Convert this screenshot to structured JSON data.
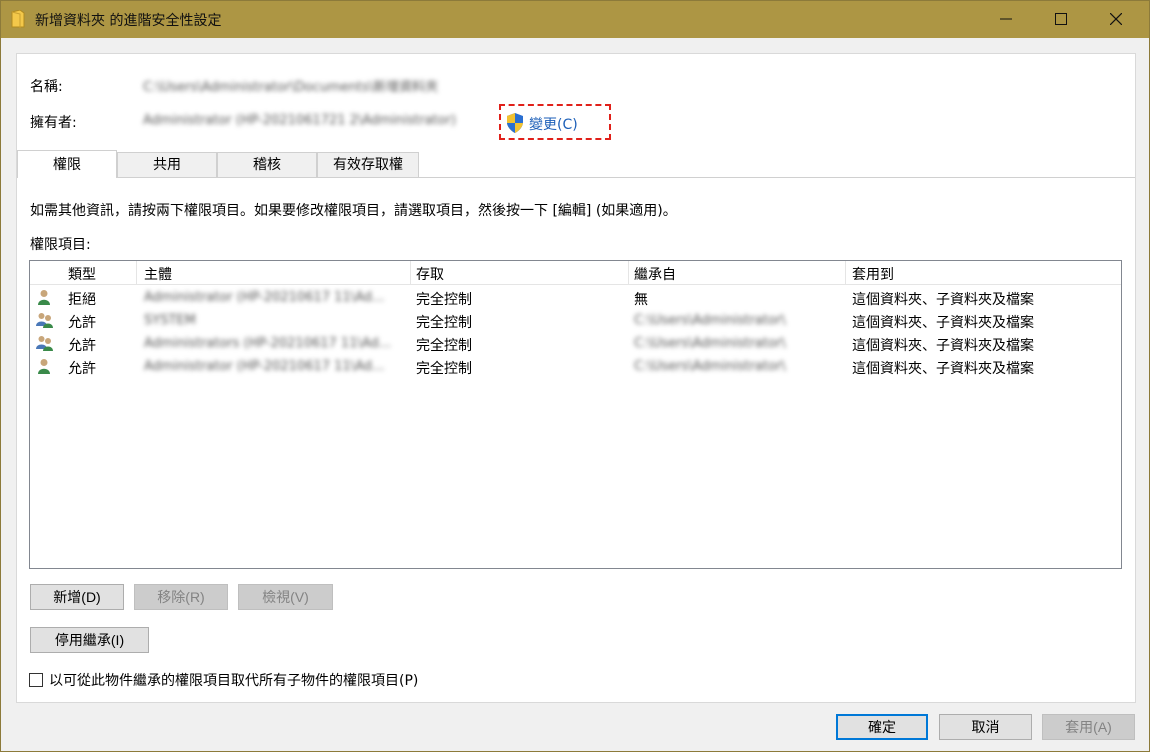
{
  "window": {
    "title": "新增資料夾 的進階安全性設定"
  },
  "header": {
    "name_label": "名稱:",
    "name_value": "C:\\Users\\Administrator\\Documents\\新增資料夾",
    "owner_label": "擁有者:",
    "owner_value": "Administrator (HP-2021061721 2\\Administrator)",
    "change_link": "變更(C)"
  },
  "tabs": [
    "權限",
    "共用",
    "稽核",
    "有效存取權"
  ],
  "active_tab": "權限",
  "description": "如需其他資訊，請按兩下權限項目。如果要修改權限項目，請選取項目，然後按一下 [編輯] (如果適用)。",
  "list_label": "權限項目:",
  "columns": [
    "類型",
    "主體",
    "存取",
    "繼承自",
    "套用到"
  ],
  "rows": [
    {
      "icon": "user-icon",
      "type": "拒絕",
      "principal": "Administrator (HP-20210617 11\\Ad...",
      "access": "完全控制",
      "inherited": "無",
      "applies": "這個資料夾、子資料夾及檔案"
    },
    {
      "icon": "users-icon",
      "type": "允許",
      "principal": "SYSTEM",
      "access": "完全控制",
      "inherited": "C:\\Users\\Administrator\\",
      "applies": "這個資料夾、子資料夾及檔案"
    },
    {
      "icon": "users-icon",
      "type": "允許",
      "principal": "Administrators (HP-20210617 11\\Ad...",
      "access": "完全控制",
      "inherited": "C:\\Users\\Administrator\\",
      "applies": "這個資料夾、子資料夾及檔案"
    },
    {
      "icon": "user-icon",
      "type": "允許",
      "principal": "Administrator (HP-20210617 11\\Ad...",
      "access": "完全控制",
      "inherited": "C:\\Users\\Administrator\\",
      "applies": "這個資料夾、子資料夾及檔案"
    }
  ],
  "buttons": {
    "add": "新增(D)",
    "remove": "移除(R)",
    "view": "檢視(V)",
    "disable_inherit": "停用繼承(I)",
    "ok": "確定",
    "cancel": "取消",
    "apply": "套用(A)"
  },
  "replace_checkbox": {
    "label": "以可從此物件繼承的權限項目取代所有子物件的權限項目(P)",
    "checked": false
  },
  "colors": {
    "titlebar": "#ad9644",
    "link": "#1c5fb8",
    "highlight_border": "#e0201a",
    "primary_border": "#0078d7"
  }
}
